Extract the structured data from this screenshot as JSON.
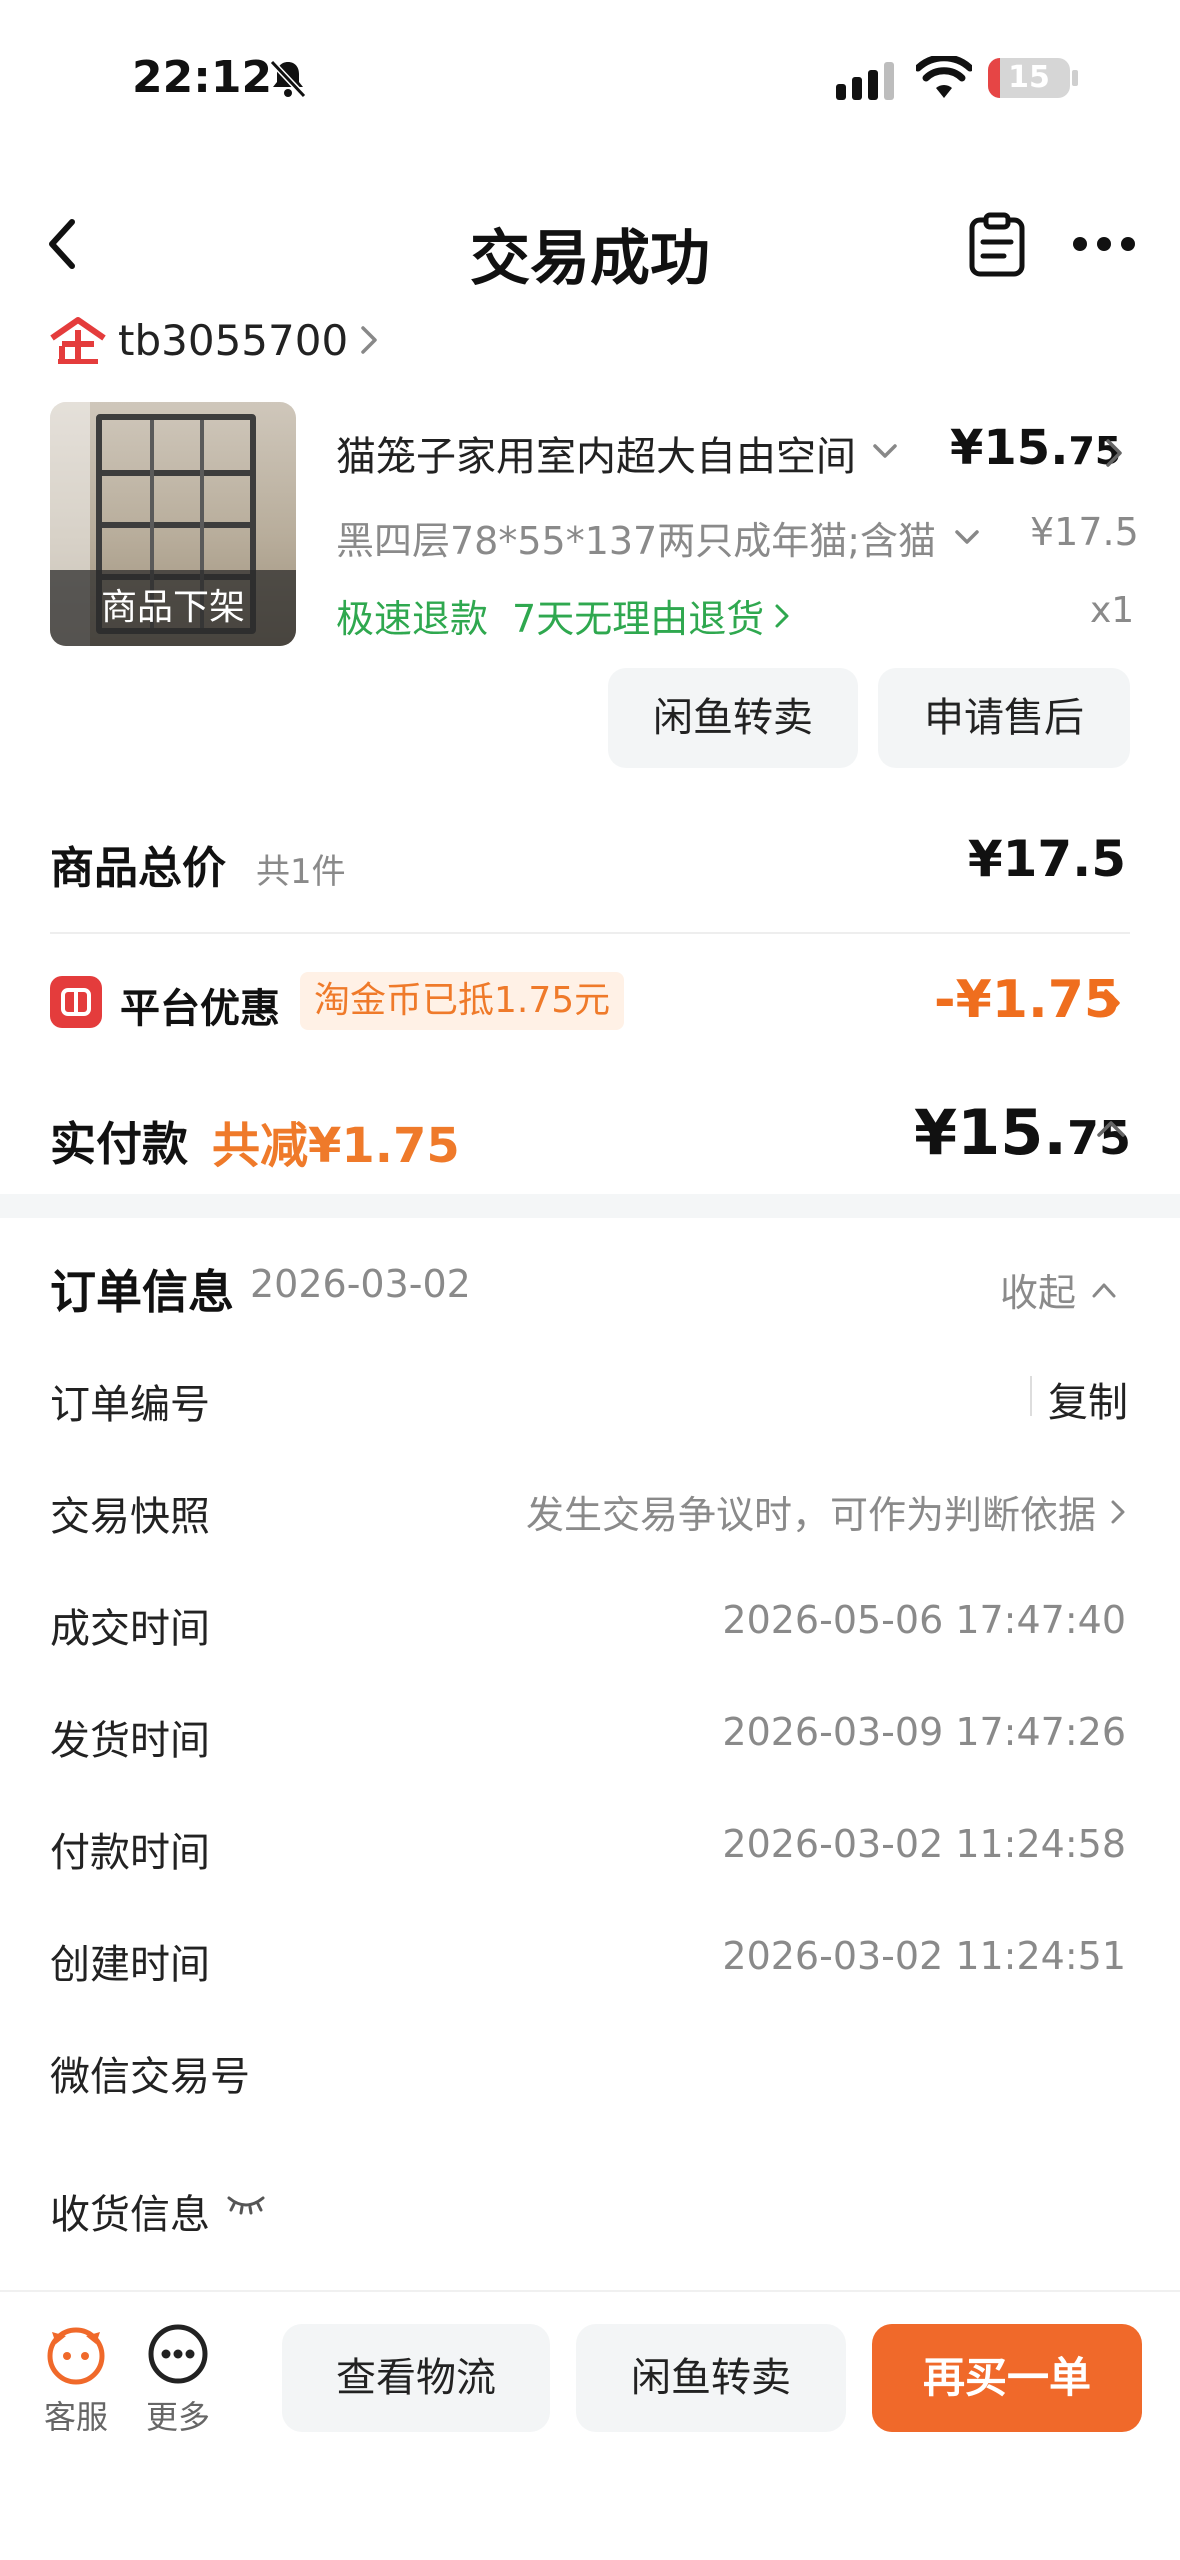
{
  "status_bar": {
    "time": "22:12",
    "battery_level": "15",
    "battery_fraction": 0.15
  },
  "nav": {
    "title": "交易成功"
  },
  "shop": {
    "name": "tb3055700"
  },
  "product": {
    "image_badge": "商品下架",
    "title": "猫笼子家用室内超大自由空间",
    "price_int": "¥15.",
    "price_dec": "75",
    "sku": "黑四层78*55*137两只成年猫;含猫",
    "original_price": "¥17.5",
    "refund_fast": "极速退款",
    "refund_7day": "7天无理由退货",
    "quantity": "x1",
    "btn_resell": "闲鱼转卖",
    "btn_aftersale": "申请售后"
  },
  "summary": {
    "total_label": "商品总价",
    "total_count": "共1件",
    "total_value": "¥17.5",
    "discount_label": "平台优惠",
    "discount_badge": "淘金币已抵1.75元",
    "discount_value": "-¥1.75",
    "paid_label": "实付款",
    "paid_reduce": "共减¥1.75",
    "paid_int": "¥15.",
    "paid_dec": "75"
  },
  "order_info": {
    "title": "订单信息",
    "date": "2026-03-02",
    "collapse": "收起",
    "copy": "复制",
    "rows": [
      {
        "label": "订单编号",
        "value": ""
      },
      {
        "label": "交易快照",
        "value": "发生交易争议时，可作为判断依据"
      },
      {
        "label": "成交时间",
        "value": "2026-05-06 17:47:40"
      },
      {
        "label": "发货时间",
        "value": "2026-03-09 17:47:26"
      },
      {
        "label": "付款时间",
        "value": "2026-03-02 11:24:58"
      },
      {
        "label": "创建时间",
        "value": "2026-03-02 11:24:51"
      },
      {
        "label": "微信交易号",
        "value": ""
      },
      {
        "label": "收货信息",
        "value": ""
      }
    ]
  },
  "bottom_bar": {
    "service_label": "客服",
    "more_label": "更多",
    "btn_logistics": "查看物流",
    "btn_resell": "闲鱼转卖",
    "btn_rebuy": "再买一单"
  },
  "colors": {
    "accent_orange": "#f0692a",
    "green": "#2fa84f",
    "brand_red": "#e43c3c"
  }
}
